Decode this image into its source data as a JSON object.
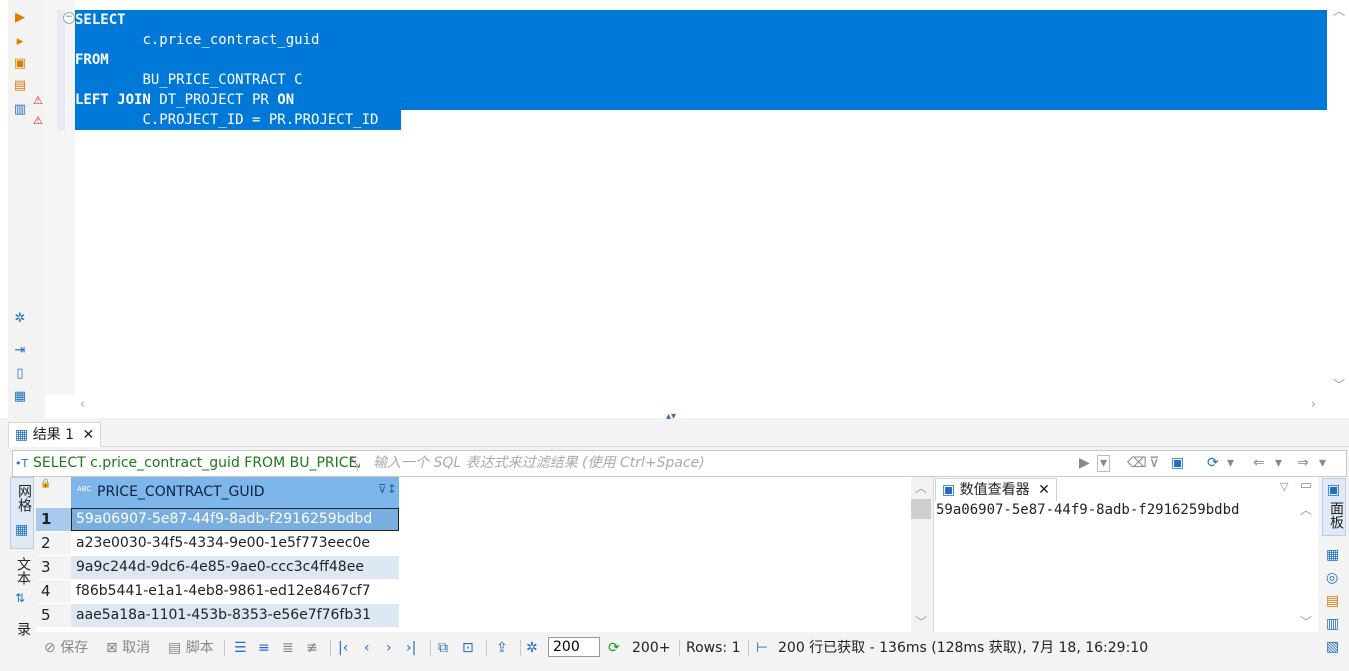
{
  "editor": {
    "lines": [
      {
        "indent": "",
        "parts": [
          {
            "t": "SELECT",
            "kw": true
          }
        ]
      },
      {
        "indent": "        ",
        "parts": [
          {
            "t": "c.price_contract_guid",
            "kw": false
          }
        ]
      },
      {
        "indent": "",
        "parts": [
          {
            "t": "FROM",
            "kw": true
          }
        ]
      },
      {
        "indent": "        ",
        "parts": [
          {
            "t": "BU_PRICE_CONTRACT C",
            "kw": false
          }
        ]
      },
      {
        "indent": "",
        "parts": [
          {
            "t": "LEFT JOIN",
            "kw": true
          },
          {
            "t": " DT_PROJECT PR ",
            "kw": false
          },
          {
            "t": "ON",
            "kw": true
          }
        ]
      },
      {
        "indent": "        ",
        "parts": [
          {
            "t": "C.PROJECT_ID = PR.PROJECT_ID",
            "kw": false
          }
        ]
      }
    ],
    "selection_color": "#0078d7",
    "fold_icon": "minus-circle-icon"
  },
  "results": {
    "tab_label": "结果 1",
    "query_text": "SELECT c.price_contract_guid FROM BU_PRICE_CONTRACT C LEFT JOIN DT_PROJECT PR ON C.PROJECT_ID = PR.PROJECT_ID",
    "filter_placeholder": "输入一个 SQL 表达式来过滤结果 (使用 Ctrl+Space)",
    "side_tab_grid": "网格",
    "side_tab_text": "文本",
    "side_tab_record": "记录",
    "column_type_badge": "ABC",
    "column_header": "PRICE_CONTRACT_GUID",
    "rows": [
      {
        "num": "1",
        "value": "59a06907-5e87-44f9-8adb-f2916259bdbd"
      },
      {
        "num": "2",
        "value": "a23e0030-34f5-4334-9e00-1e5f773eec0e"
      },
      {
        "num": "3",
        "value": "9a9c244d-9dc6-4e85-9ae0-ccc3c4ff48ee"
      },
      {
        "num": "4",
        "value": "f86b5441-e1a1-4eb8-9861-ed12e8467cf7"
      },
      {
        "num": "5",
        "value": "aae5a18a-1101-453b-8353-e56e7f76fb31"
      }
    ]
  },
  "viewer": {
    "tab_label": "数值查看器",
    "value": "59a06907-5e87-44f9-8adb-f2916259bdbd",
    "right_tab_label": "面板"
  },
  "statusbar": {
    "save": "保存",
    "cancel": "取消",
    "script": "脚本",
    "fetch_size": "200",
    "fetch_more": "200+",
    "rows_label": "Rows: 1",
    "fetch_info": "200 行已获取 - 136ms (128ms 获取), 7月 18, 16:29:10"
  }
}
